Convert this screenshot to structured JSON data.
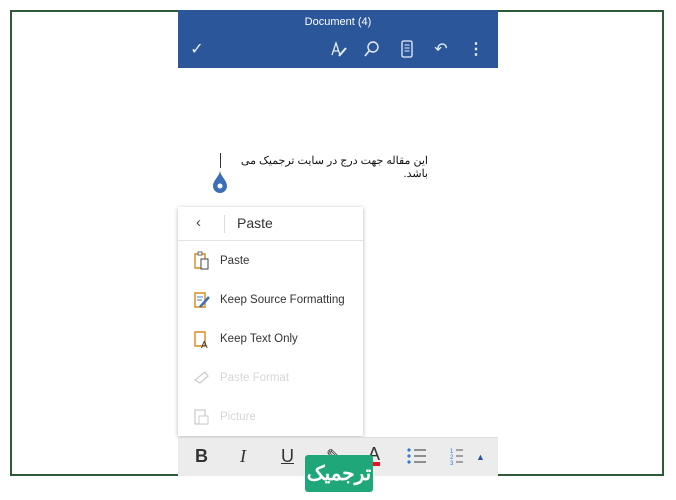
{
  "header": {
    "title": "Document (4)"
  },
  "document": {
    "text": "این مقاله جهت درج در سایت ترجمیک می باشد."
  },
  "paste_menu": {
    "title": "Paste",
    "items": [
      {
        "label": "Paste",
        "enabled": true,
        "icon": "clipboard-icon"
      },
      {
        "label": "Keep Source Formatting",
        "enabled": true,
        "icon": "clipboard-brush-icon"
      },
      {
        "label": "Keep Text Only",
        "enabled": true,
        "icon": "clipboard-text-icon"
      },
      {
        "label": "Paste Format",
        "enabled": false,
        "icon": "format-painter-icon"
      },
      {
        "label": "Picture",
        "enabled": false,
        "icon": "clipboard-picture-icon"
      }
    ]
  },
  "toolbar": {
    "bold": "B",
    "italic": "I",
    "underline": "U",
    "font_color": "A",
    "font_color_value": "#e81123"
  },
  "watermark": {
    "text": "ترجمیک"
  },
  "colors": {
    "header": "#2b579a",
    "accent": "#d68a1c",
    "watermark": "#1fa77a"
  }
}
